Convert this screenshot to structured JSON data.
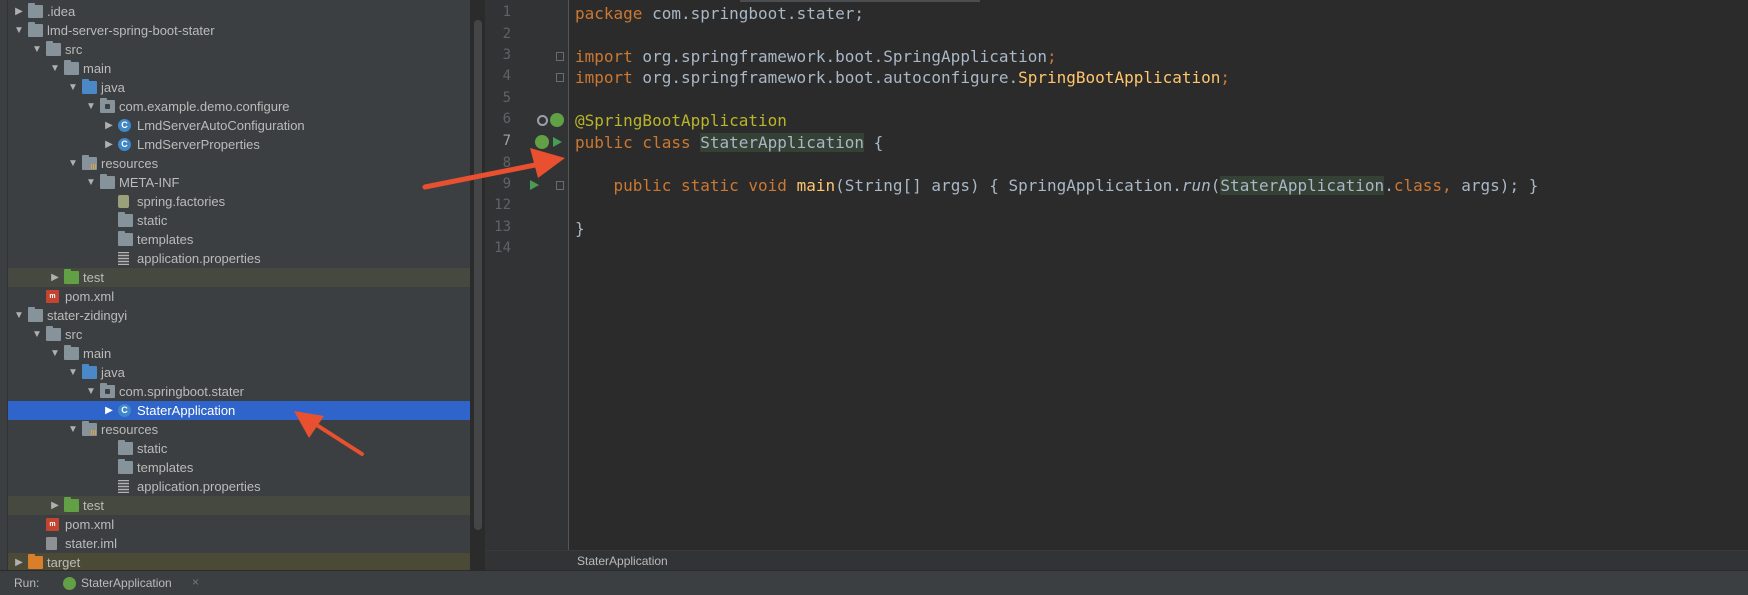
{
  "project_tree": {
    "rows": [
      {
        "label": ".idea",
        "icon": "folder-icon",
        "expanded": false
      },
      {
        "label": "lmd-server-spring-boot-stater",
        "icon": "folder-icon",
        "expanded": true
      },
      {
        "label": "src",
        "icon": "folder-icon",
        "expanded": true
      },
      {
        "label": "main",
        "icon": "folder-icon",
        "expanded": true
      },
      {
        "label": "java",
        "icon": "source-folder-icon",
        "expanded": true
      },
      {
        "label": "com.example.demo.configure",
        "icon": "package-icon",
        "expanded": true
      },
      {
        "label": "LmdServerAutoConfiguration",
        "icon": "class-icon",
        "expanded": false
      },
      {
        "label": "LmdServerProperties",
        "icon": "class-icon",
        "expanded": false
      },
      {
        "label": "resources",
        "icon": "resources-folder-icon",
        "expanded": true
      },
      {
        "label": "META-INF",
        "icon": "folder-icon",
        "expanded": true
      },
      {
        "label": "spring.factories",
        "icon": "spring-factories-icon"
      },
      {
        "label": "static",
        "icon": "folder-icon"
      },
      {
        "label": "templates",
        "icon": "folder-icon"
      },
      {
        "label": "application.properties",
        "icon": "properties-file-icon"
      },
      {
        "label": "test",
        "icon": "test-folder-icon",
        "expanded": false
      },
      {
        "label": "pom.xml",
        "icon": "maven-file-icon"
      },
      {
        "label": "stater-zidingyi",
        "icon": "folder-icon",
        "expanded": true
      },
      {
        "label": "src",
        "icon": "folder-icon",
        "expanded": true
      },
      {
        "label": "main",
        "icon": "folder-icon",
        "expanded": true
      },
      {
        "label": "java",
        "icon": "source-folder-icon",
        "expanded": true
      },
      {
        "label": "com.springboot.stater",
        "icon": "package-icon",
        "expanded": true
      },
      {
        "label": "StaterApplication",
        "icon": "spring-boot-class-icon",
        "expanded": false,
        "selected": true
      },
      {
        "label": "resources",
        "icon": "resources-folder-icon",
        "expanded": true
      },
      {
        "label": "static",
        "icon": "folder-icon"
      },
      {
        "label": "templates",
        "icon": "folder-icon"
      },
      {
        "label": "application.properties",
        "icon": "properties-file-icon"
      },
      {
        "label": "test",
        "icon": "test-folder-icon",
        "expanded": false
      },
      {
        "label": "pom.xml",
        "icon": "maven-file-icon"
      },
      {
        "label": "stater.iml",
        "icon": "iml-file-icon"
      },
      {
        "label": "target",
        "icon": "excluded-folder-icon",
        "expanded": false
      }
    ]
  },
  "editor": {
    "line_numbers": [
      "1",
      "2",
      "3",
      "4",
      "5",
      "6",
      "7",
      "8",
      "9",
      "12",
      "13",
      "14"
    ],
    "code": {
      "l1_kw": "package",
      "l1_rest": " com.springboot.stater;",
      "l3_kw": "import",
      "l3_rest": " org.springframework.boot.SpringApplication",
      "l3_semi": ";",
      "l4_kw": "import",
      "l4_rest": " org.springframework.boot.autoconfigure.",
      "l4_cls": "SpringBootApplication",
      "l4_semi": ";",
      "l6_ann": "@SpringBootApplication",
      "l7_kw": "public class",
      "l7_space": " ",
      "l7_cls": "StaterApplication",
      "l7_rest": " {",
      "l9_indent": "    ",
      "l9_kw": "public static void",
      "l9_sp": " ",
      "l9_fn": "main",
      "l9_params": "(String[] args) { SpringApplication.",
      "l9_run": "run",
      "l9_paren": "(",
      "l9_cls": "StaterApplication",
      "l9_dot": ".",
      "l9_class_kw": "class",
      "l9_comma": ",",
      "l9_end": " args); }",
      "l13": "}"
    },
    "breadcrumb": "StaterApplication"
  },
  "run_bar": {
    "label": "Run:",
    "tab_label": "StaterApplication",
    "close": "×"
  },
  "colors": {
    "selection": "#2f65ca",
    "annotation_arrow": "#e8502f",
    "keyword": "#cc7832",
    "annotation": "#bbb529",
    "function": "#ffc66d"
  }
}
